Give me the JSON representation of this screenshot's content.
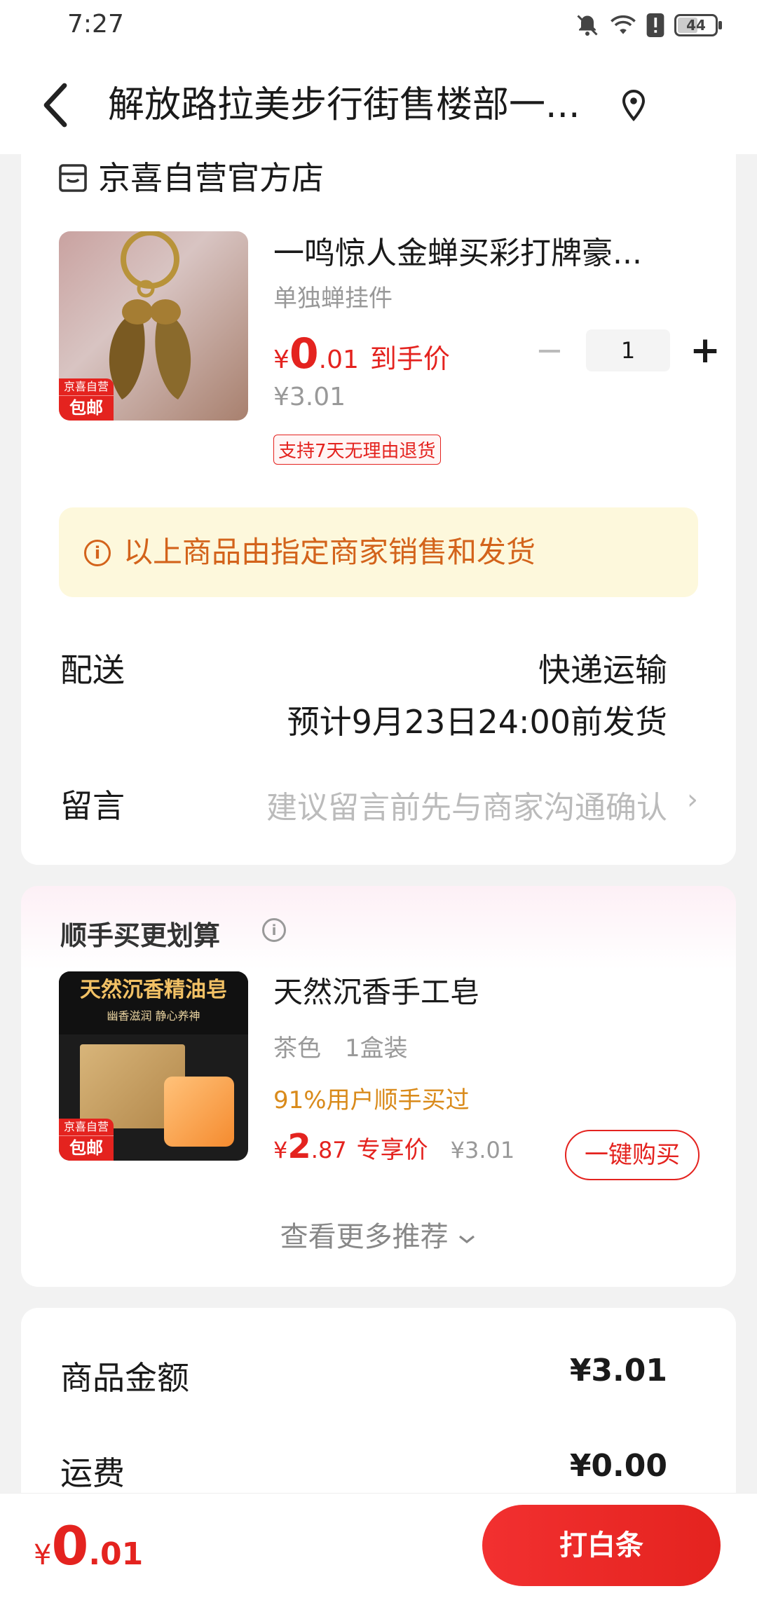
{
  "status_bar": {
    "time": "7:27",
    "battery": "44",
    "icons": [
      "bell-muted-icon",
      "wifi-icon",
      "alert-icon",
      "battery-icon"
    ]
  },
  "nav": {
    "title": "解放路拉美步行街售楼部一...",
    "icons": [
      "back-icon",
      "location-pin-icon"
    ]
  },
  "store": {
    "name": "京喜自营官方店"
  },
  "product": {
    "title": "一鸣惊人金蝉买彩打牌豪...",
    "spec": "单独蝉挂件",
    "price_currency": "¥",
    "price_int": "0",
    "price_dec": ".01",
    "price_tag": "到手价",
    "original_price": "¥3.01",
    "return_policy": "支持7天无理由退货",
    "quantity": "1",
    "badge_top": "京喜自营",
    "badge_bottom": "包邮"
  },
  "notice": {
    "text": "以上商品由指定商家销售和发货"
  },
  "delivery": {
    "label": "配送",
    "method": "快递运输",
    "estimate": "预计9月23日24:00前发货"
  },
  "message": {
    "label": "留言",
    "placeholder": "建议留言前先与商家沟通确认"
  },
  "recommend": {
    "section_title": "顺手买更划算",
    "item": {
      "image_title": "天然沉香精油皂",
      "image_subtitle": "幽香滋润 静心养神",
      "title": "天然沉香手工皂",
      "spec_color": "茶色",
      "spec_pack": "1盒装",
      "stat": "91%用户顺手买过",
      "price_currency": "¥",
      "price_int": "2",
      "price_dec": ".87",
      "price_tag": "专享价",
      "original_price": "¥3.01",
      "buy_label": "一键购买",
      "badge_top": "京喜自营",
      "badge_bottom": "包邮"
    },
    "more_label": "查看更多推荐"
  },
  "summary": {
    "goods_label": "商品金额",
    "goods_value": "¥3.01",
    "shipping_label": "运费",
    "shipping_value": "¥0.00"
  },
  "footer": {
    "total_currency": "¥",
    "total_int": "0",
    "total_dec": ".01",
    "pay_label": "打白条"
  },
  "colors": {
    "accent": "#e4231f",
    "notice_text": "#d3631b",
    "notice_bg": "#fdf8dc",
    "stat_text": "#d98a1a"
  }
}
